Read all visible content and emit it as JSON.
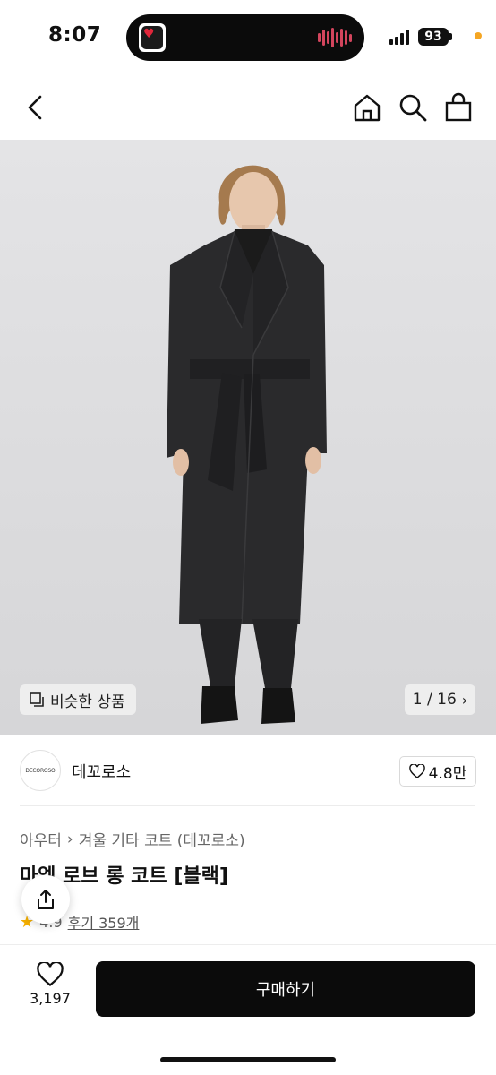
{
  "status_bar": {
    "time": "8:07",
    "battery": "93",
    "island_app_icon": "heart-app-icon"
  },
  "nav": {
    "back_icon": "chevron-left-icon",
    "home_icon": "home-icon",
    "search_icon": "search-icon",
    "bag_icon": "shopping-bag-icon"
  },
  "gallery": {
    "similar_label": "비슷한 상품",
    "pager": "1 / 16"
  },
  "brand": {
    "logo_text": "DECOROSO",
    "name": "데꼬로소",
    "likes": "4.8만"
  },
  "product": {
    "breadcrumb": [
      "아우터",
      "겨울 기타 코트 (데꼬로소)"
    ],
    "title": "마엘 로브 롱 코트 [블랙]",
    "rating": "4.9",
    "reviews": "후기 359개"
  },
  "bottom_bar": {
    "fav_count": "3,197",
    "buy_label": "구매하기"
  },
  "colors": {
    "accent_dark": "#0b0b0b",
    "star": "#f5b000",
    "status_dot": "#f5a623"
  }
}
